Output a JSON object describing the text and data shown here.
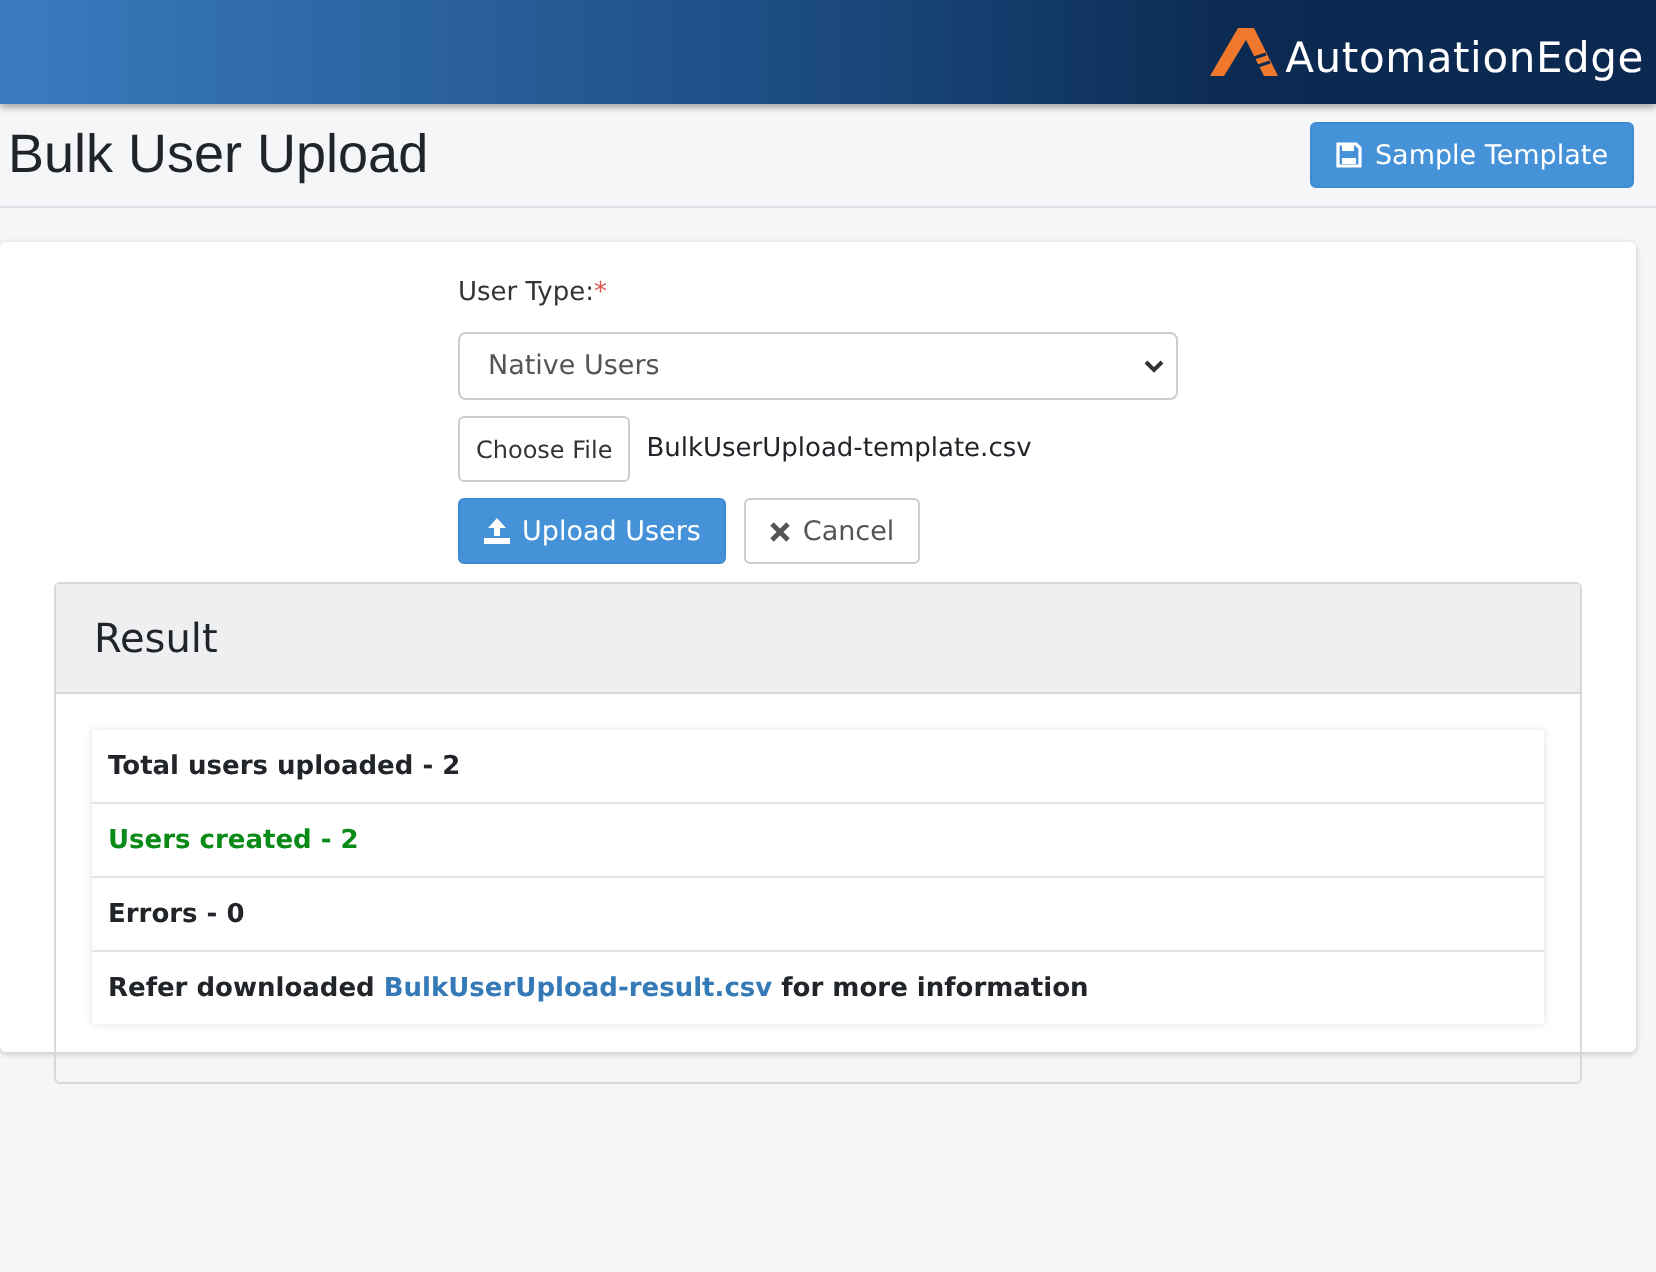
{
  "header": {
    "logo_text": "AutomationEdge"
  },
  "page": {
    "title": "Bulk User Upload",
    "template_button": "Sample Template"
  },
  "form": {
    "user_type_label": "User Type:",
    "required_mark": "*",
    "user_type_value": "Native Users",
    "choose_file_button": "Choose File",
    "file_name": "BulkUserUpload-template.csv",
    "upload_button": "Upload Users",
    "cancel_button": "Cancel"
  },
  "result": {
    "title": "Result",
    "rows": [
      {
        "kind": "plain",
        "text": "Total users uploaded - 2"
      },
      {
        "kind": "success",
        "text": "Users created - 2"
      },
      {
        "kind": "plain",
        "text": "Errors - 0"
      },
      {
        "kind": "link",
        "text": "Refer downloaded ",
        "link": "BulkUserUpload-result.csv",
        "text_after": " for more information"
      }
    ]
  }
}
